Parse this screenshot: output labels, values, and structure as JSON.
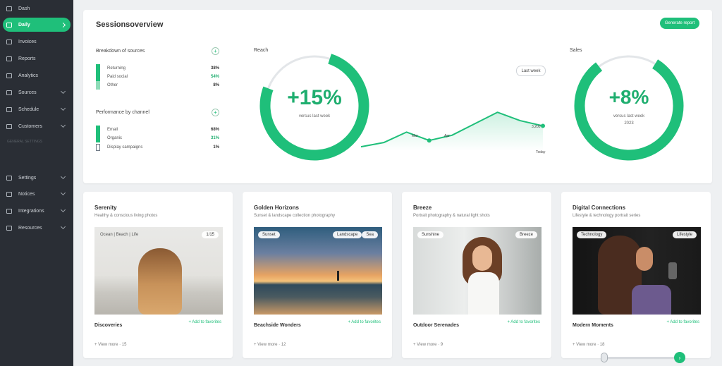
{
  "sidebar": {
    "items": [
      {
        "label": "Dash"
      },
      {
        "label": "Daily"
      },
      {
        "label": "Invoices"
      },
      {
        "label": "Reports"
      },
      {
        "label": "Analytics"
      },
      {
        "label": "Sources"
      },
      {
        "label": "Schedule"
      },
      {
        "label": "Customers"
      },
      {
        "label": "Settings"
      },
      {
        "label": "Notices"
      },
      {
        "label": "Integrations"
      },
      {
        "label": "Resources"
      }
    ],
    "section_label": "GENERAL SETTINGS"
  },
  "overview": {
    "title": "Sessionsoverview",
    "action_label": "Generate report",
    "list1": {
      "title": "Breakdown of sources",
      "rows": [
        {
          "name": "Returning",
          "value": "38%"
        },
        {
          "name": "Paid social",
          "value": "54%"
        },
        {
          "name": "Other",
          "value": "8%"
        }
      ]
    },
    "list2": {
      "title": "Performance by channel",
      "rows": [
        {
          "name": "Email",
          "value": "68%"
        },
        {
          "name": "Organic",
          "value": "31%"
        },
        {
          "name": "Display campaigns",
          "value": "1%"
        }
      ]
    },
    "chart1_label": "Reach",
    "ring1_value": "+15%",
    "ring1_sub": "versus last week",
    "period_label": "Last week",
    "trend_point_labels": [
      "Mar",
      "Apr"
    ],
    "trend_end_label": "3,200",
    "trend_axis_label": "Today",
    "chart2_label": "Sales",
    "ring2_value": "+8%",
    "ring2_sub": "versus last week",
    "ring2_sub2": "2023"
  },
  "chart_data": [
    {
      "type": "line",
      "x": [
        "",
        "",
        "",
        "",
        "",
        "",
        "",
        "",
        ""
      ],
      "values": [
        8,
        16,
        36,
        20,
        30,
        52,
        74,
        58,
        48
      ],
      "ylim": [
        0,
        100
      ]
    }
  ],
  "cards": [
    {
      "title": "Serenity",
      "subtitle": "Healthy & conscious living photos",
      "tag_left": "Ocean | Beach | Life",
      "tag_right": "1/15",
      "footer_title": "Discoveries",
      "footer_link": "+ Add to favorites",
      "footer_meta": "+ View more · 15"
    },
    {
      "title": "Golden Horizons",
      "subtitle": "Sunset & landscape collection photography",
      "tag_left": "Sunset",
      "tag_right": "Landscape",
      "tag_right2": "Sea",
      "footer_title": "Beachside Wonders",
      "footer_link": "+ Add to favorites",
      "footer_meta": "+ View more · 12"
    },
    {
      "title": "Breeze",
      "subtitle": "Portrait photography & natural light shots",
      "tag_left": "Sunshine",
      "tag_right": "Breeze",
      "footer_title": "Outdoor Serenades",
      "footer_link": "+ Add to favorites",
      "footer_meta": "+ View more · 9"
    },
    {
      "title": "Digital Connections",
      "subtitle": "Lifestyle & technology portrait series",
      "tag_left": "Technology",
      "tag_right": "Lifestyle",
      "footer_title": "Modern Moments",
      "footer_link": "+ Add to favorites",
      "footer_meta": "+ View more · 18"
    }
  ],
  "colors": {
    "accent": "#1fbf7a",
    "sidebar": "#2a2e35"
  }
}
